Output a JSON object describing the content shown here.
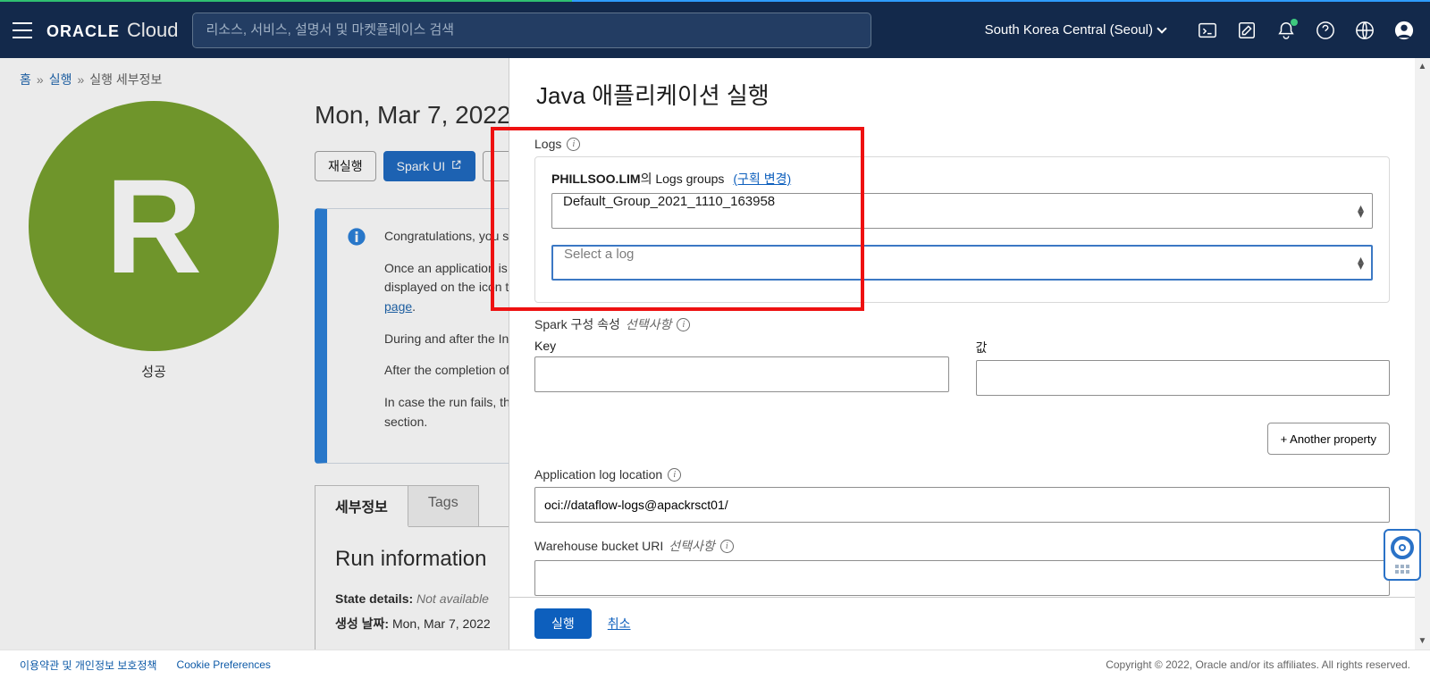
{
  "header": {
    "brand_main": "ORACLE",
    "brand_sub": "Cloud",
    "search_placeholder": "리소스, 서비스, 설명서 및 마켓플레이스 검색",
    "region": "South Korea Central (Seoul)"
  },
  "breadcrumb": {
    "home": "홈",
    "runs": "실행",
    "current": "실행 세부정보"
  },
  "left": {
    "avatar_letter": "R",
    "status": "성공"
  },
  "page": {
    "title": "Mon, Mar 7, 2022",
    "btn_rerun": "재실행",
    "btn_sparkui": "Spark UI",
    "notice": {
      "line1": "Congratulations, you s",
      "line2a": "Once an application is ",
      "line2b": "displayed on the icon t",
      "line2link": "page",
      "line2dot": ".",
      "line3": "During and after the In",
      "line4": "After the completion of",
      "line5": "In case the run fails, th",
      "line5b": "section."
    },
    "tabs": {
      "details": "세부정보",
      "tags": "Tags"
    },
    "panel_title": "Run information",
    "state_k": "State details:",
    "state_v": "Not available",
    "created_k": "생성 날짜:",
    "created_v": "Mon, Mar 7, 2022"
  },
  "drawer": {
    "title": "Java 애플리케이션 실행",
    "logs_label": "Logs",
    "logs_group_owner": "PHILLSOO.LIM",
    "logs_group_tail": "의 Logs groups",
    "change_compartment": "(구획 변경)",
    "log_group_selected": "Default_Group_2021_1110_163958",
    "log_select_placeholder": "Select a log",
    "spark_conf_label": "Spark 구성 속성",
    "optional": "선택사항",
    "key_label": "Key",
    "value_label": "값",
    "add_property": "+ Another property",
    "app_log_label": "Application log location",
    "app_log_value": "oci://dataflow-logs@apackrsct01/",
    "warehouse_label": "Warehouse bucket URI",
    "run_btn": "실행",
    "cancel": "취소"
  },
  "footer": {
    "terms": "이용약관 및 개인정보 보호정책",
    "cookies": "Cookie Preferences",
    "copy": "Copyright © 2022, Oracle and/or its affiliates. All rights reserved."
  }
}
